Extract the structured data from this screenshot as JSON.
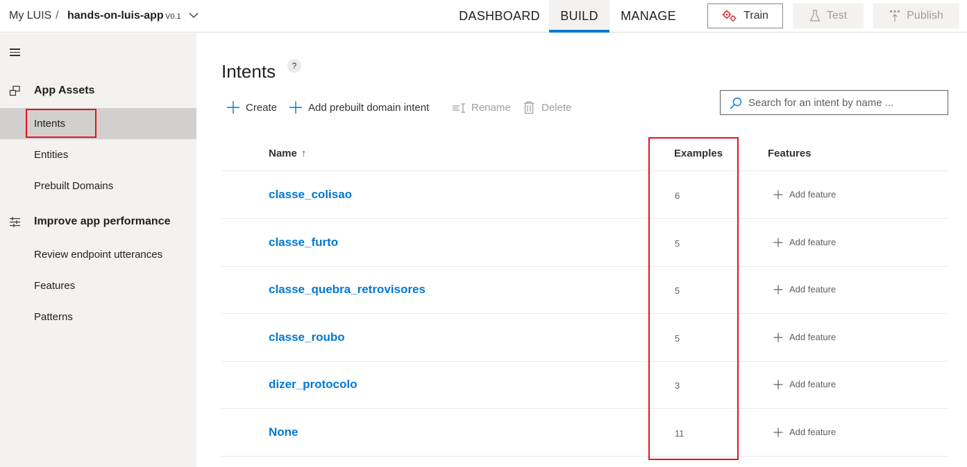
{
  "breadcrumb": {
    "home": "My LUIS",
    "separator": "/",
    "app_name": "hands-on-luis-app",
    "version": "V0.1"
  },
  "nav": {
    "tabs": [
      {
        "label": "DASHBOARD",
        "active": false
      },
      {
        "label": "BUILD",
        "active": true
      },
      {
        "label": "MANAGE",
        "active": false
      }
    ]
  },
  "actions": {
    "train": "Train",
    "test": "Test",
    "publish": "Publish"
  },
  "sidebar": {
    "sections": [
      {
        "label": "App Assets",
        "icon": "app-assets-icon",
        "items": [
          {
            "label": "Intents",
            "active": true
          },
          {
            "label": "Entities",
            "active": false
          },
          {
            "label": "Prebuilt Domains",
            "active": false
          }
        ]
      },
      {
        "label": "Improve app performance",
        "icon": "sliders-icon",
        "items": [
          {
            "label": "Review endpoint utterances",
            "active": false
          },
          {
            "label": "Features",
            "active": false
          },
          {
            "label": "Patterns",
            "active": false
          }
        ]
      }
    ]
  },
  "main": {
    "title": "Intents",
    "help": "?",
    "commands": {
      "create": "Create",
      "add_prebuilt": "Add prebuilt domain intent",
      "rename": "Rename",
      "delete": "Delete"
    },
    "search": {
      "placeholder": "Search for an intent by name ..."
    },
    "table": {
      "columns": {
        "name": "Name",
        "examples": "Examples",
        "features": "Features"
      },
      "sort_indicator": "↑",
      "rows": [
        {
          "name": "classe_colisao",
          "examples": "6",
          "feature_action": "Add feature"
        },
        {
          "name": "classe_furto",
          "examples": "5",
          "feature_action": "Add feature"
        },
        {
          "name": "classe_quebra_retrovisores",
          "examples": "5",
          "feature_action": "Add feature"
        },
        {
          "name": "classe_roubo",
          "examples": "5",
          "feature_action": "Add feature"
        },
        {
          "name": "dizer_protocolo",
          "examples": "3",
          "feature_action": "Add feature"
        },
        {
          "name": "None",
          "examples": "11",
          "feature_action": "Add feature"
        }
      ]
    }
  },
  "colors": {
    "accent": "#0078d4",
    "highlight_box": "#e81123",
    "sidebar_bg": "#f3f2f1",
    "train_icon": "#d13438"
  }
}
